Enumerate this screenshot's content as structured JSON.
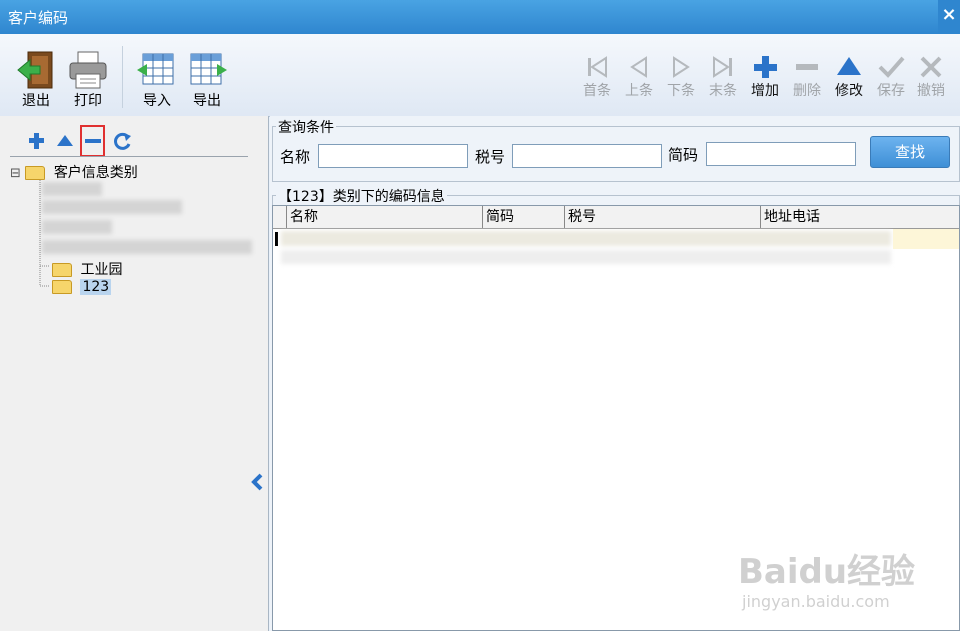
{
  "window": {
    "title": "客户编码",
    "close_glyph": "×"
  },
  "toolbar": {
    "exit_label": "退出",
    "print_label": "打印",
    "import_label": "导入",
    "export_label": "导出",
    "nav": {
      "first_label": "首条",
      "prev_label": "上条",
      "next_label": "下条",
      "last_label": "末条",
      "add_label": "增加",
      "delete_label": "删除",
      "edit_label": "修改",
      "save_label": "保存",
      "cancel_label": "撤销"
    }
  },
  "tree": {
    "root_label": "客户信息类别",
    "expand_glyph": "⊟",
    "items": [
      {
        "label": "工业园"
      },
      {
        "label": "123",
        "selected": true
      }
    ]
  },
  "query": {
    "legend": "查询条件",
    "name_label": "名称",
    "taxno_label": "税号",
    "shortcode_label": "简码",
    "name_value": "",
    "taxno_value": "",
    "shortcode_value": "",
    "search_label": "查找"
  },
  "list": {
    "legend": "【123】类别下的编码信息",
    "columns": [
      "名称",
      "简码",
      "税号",
      "地址电话"
    ]
  },
  "watermark": {
    "brand": "Baidu经验",
    "url": "jingyan.baidu.com"
  },
  "colors": {
    "accent": "#2f86cf",
    "nav_blue": "#2b73c9",
    "highlight_red": "#e03030"
  }
}
